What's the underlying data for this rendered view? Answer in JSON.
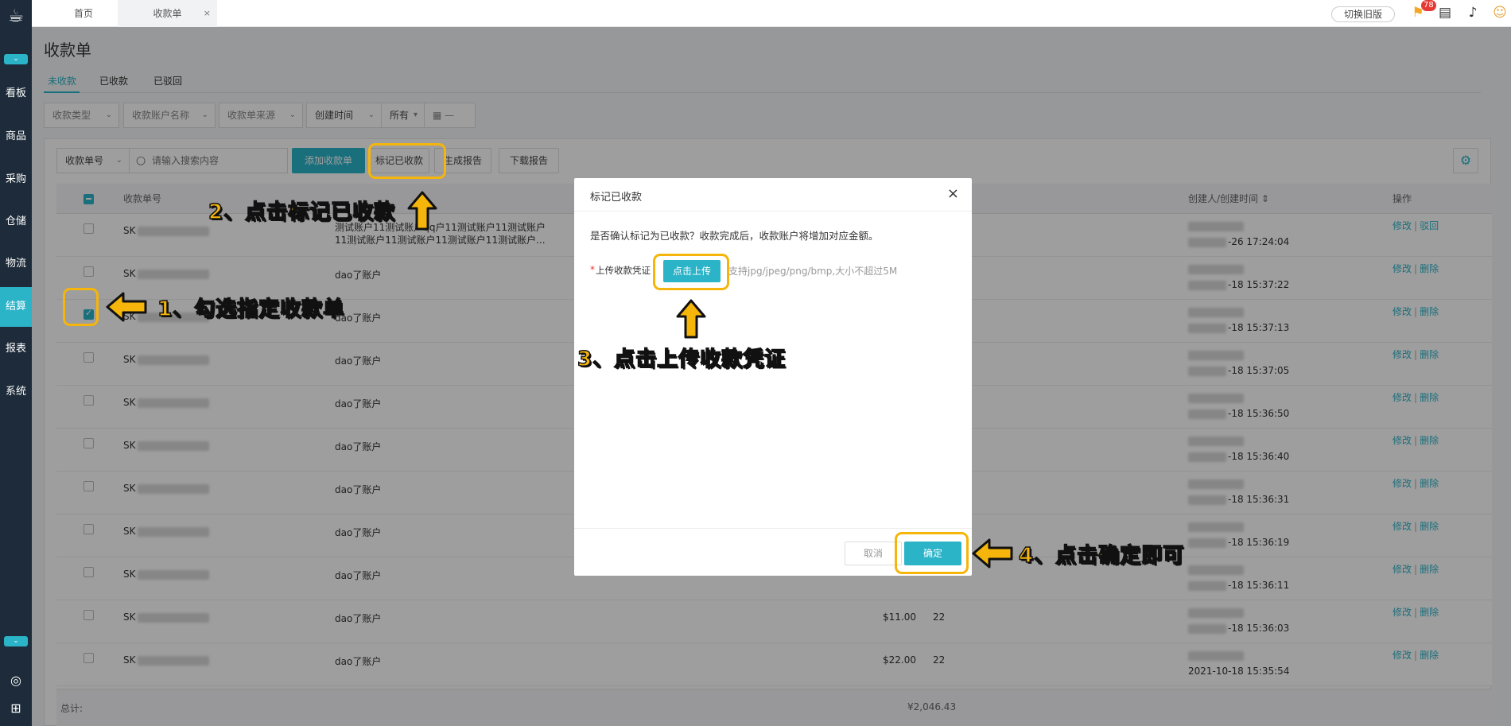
{
  "sidebar": {
    "logo": "☕",
    "items": [
      {
        "label": "看板"
      },
      {
        "label": "商品"
      },
      {
        "label": "采购"
      },
      {
        "label": "仓储"
      },
      {
        "label": "物流"
      },
      {
        "label": "结算"
      },
      {
        "label": "报表"
      },
      {
        "label": "系统"
      }
    ]
  },
  "topbar": {
    "tabs": [
      {
        "label": "首页"
      },
      {
        "label": "收款单",
        "close": "×"
      }
    ],
    "old_version_label": "切换旧版",
    "notification_count": "78"
  },
  "page": {
    "title": "收款单",
    "subtabs": [
      {
        "label": "未收款"
      },
      {
        "label": "已收款"
      },
      {
        "label": "已驳回"
      }
    ]
  },
  "filters": {
    "type": "收款类型",
    "account": "收款账户名称",
    "source": "收款单来源",
    "created": "创建时间",
    "range": "所有",
    "date_sep": "—"
  },
  "toolbar": {
    "search_field": "收款单号",
    "search_placeholder": "请输入搜索内容",
    "add": "添加收款单",
    "mark": "标记已收款",
    "report": "生成报告",
    "download": "下载报告"
  },
  "table": {
    "headers": {
      "no": "收款单号",
      "creator": "创建人/创建时间 ⇕",
      "actions": "操作"
    },
    "rows": [
      {
        "no_prefix": "SK",
        "account": "测试账户11测试账户qq户11测试账户11测试账户",
        "account2": "11测试账户11测试账户11测试账户11测试账户...",
        "amount": "",
        "qty": "",
        "time": "-26 17:24:04",
        "op1": "修改",
        "op2": "驳回",
        "checked": false
      },
      {
        "no_prefix": "SK",
        "account": "dao了账户",
        "account2": "",
        "amount": "",
        "qty": "",
        "time": "-18 15:37:22",
        "op1": "修改",
        "op2": "删除",
        "checked": false
      },
      {
        "no_prefix": "SK",
        "account": "dao了账户",
        "account2": "",
        "amount": "",
        "qty": "",
        "time": "-18 15:37:13",
        "op1": "修改",
        "op2": "删除",
        "checked": true
      },
      {
        "no_prefix": "SK",
        "account": "dao了账户",
        "account2": "",
        "amount": "",
        "qty": "",
        "time": "-18 15:37:05",
        "op1": "修改",
        "op2": "删除",
        "checked": false
      },
      {
        "no_prefix": "SK",
        "account": "dao了账户",
        "account2": "",
        "amount": "",
        "qty": "",
        "time": "-18 15:36:50",
        "op1": "修改",
        "op2": "删除",
        "checked": false
      },
      {
        "no_prefix": "SK",
        "account": "dao了账户",
        "account2": "",
        "amount": "",
        "qty": "",
        "time": "-18 15:36:40",
        "op1": "修改",
        "op2": "删除",
        "checked": false
      },
      {
        "no_prefix": "SK",
        "account": "dao了账户",
        "account2": "",
        "amount": "",
        "qty": "",
        "time": "-18 15:36:31",
        "op1": "修改",
        "op2": "删除",
        "checked": false
      },
      {
        "no_prefix": "SK",
        "account": "dao了账户",
        "account2": "",
        "amount": "",
        "qty": "",
        "time": "-18 15:36:19",
        "op1": "修改",
        "op2": "删除",
        "checked": false
      },
      {
        "no_prefix": "SK",
        "account": "dao了账户",
        "account2": "",
        "amount": "",
        "qty": "",
        "time": "-18 15:36:11",
        "op1": "修改",
        "op2": "删除",
        "checked": false
      },
      {
        "no_prefix": "SK",
        "account": "dao了账户",
        "account2": "",
        "amount": "$11.00",
        "qty": "22",
        "time": "-18 15:36:03",
        "op1": "修改",
        "op2": "删除",
        "checked": false
      },
      {
        "no_prefix": "SK",
        "account": "dao了账户",
        "account2": "",
        "amount": "$22.00",
        "qty": "22",
        "time": "2021-10-18 15:35:54",
        "op1": "修改",
        "op2": "删除",
        "checked": false
      }
    ],
    "footer": {
      "label": "总计:",
      "total": "¥2,046.43"
    }
  },
  "modal": {
    "title": "标记已收款",
    "close": "×",
    "message": "是否确认标记为已收款？收款完成后，收款账户将增加对应金额。",
    "required_mark": "*",
    "upload_label": "上传收款凭证",
    "upload_button": "点击上传",
    "upload_hint": "支持jpg/jpeg/png/bmp,大小不超过5M",
    "cancel": "取消",
    "confirm": "确定"
  },
  "annotations": {
    "step1": "1、勾选指定收款单",
    "step2": "2、点击标记已收款",
    "step3": "3、点击上传收款凭证",
    "step4": "4、点击确定即可"
  },
  "colors": {
    "accent": "#2bb3c8",
    "sidebar": "#1d2b3a",
    "annotation": "#f5b50a"
  }
}
